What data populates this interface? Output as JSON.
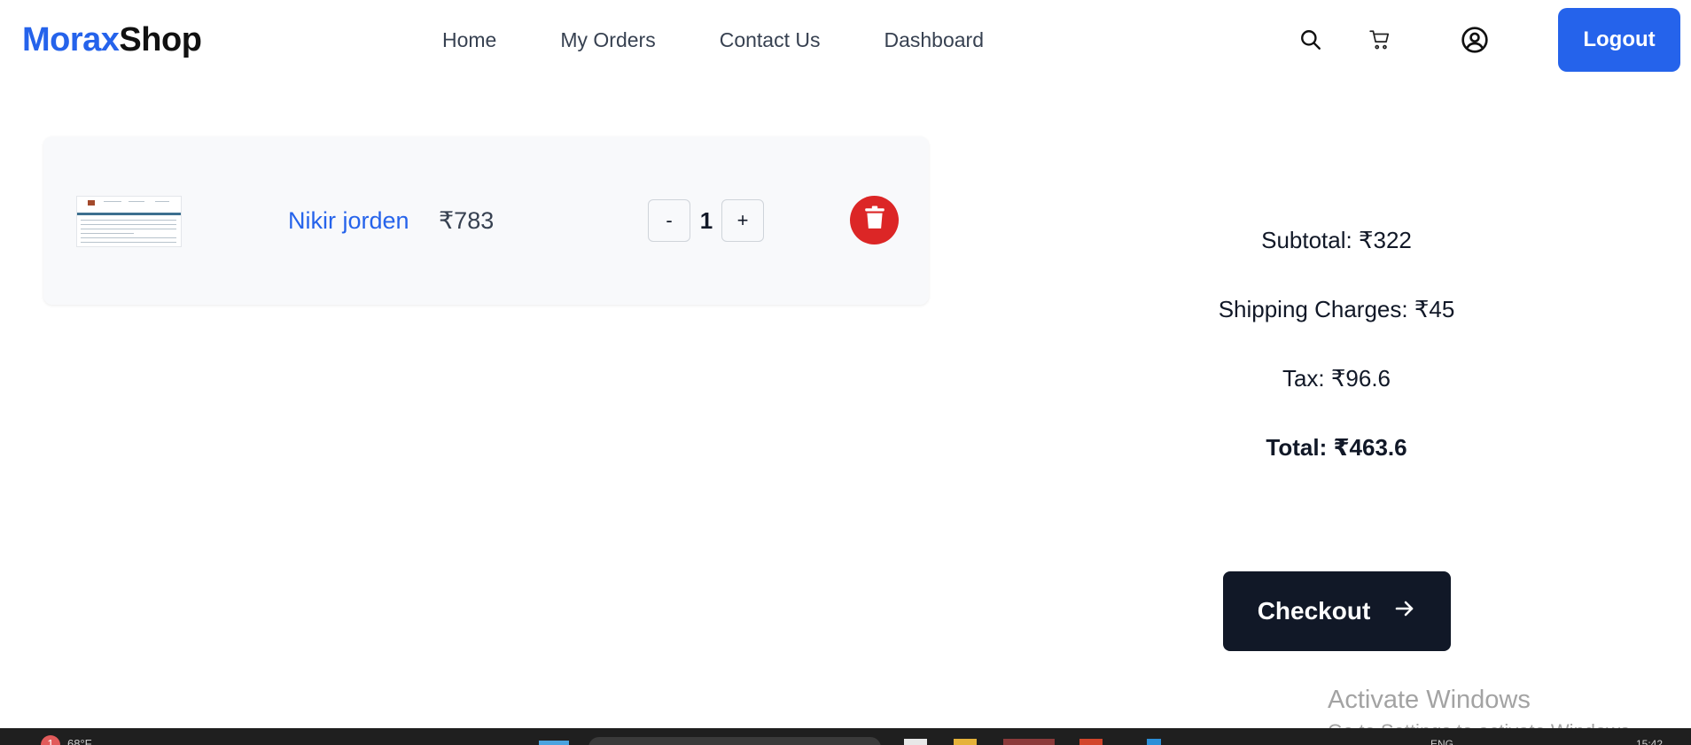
{
  "brand": {
    "part1": "Morax",
    "part2": "Shop",
    "color_primary": "#2563eb"
  },
  "nav": {
    "items": [
      {
        "label": "Home"
      },
      {
        "label": "My Orders"
      },
      {
        "label": "Contact Us"
      },
      {
        "label": "Dashboard"
      }
    ]
  },
  "header_actions": {
    "icons": [
      "search-icon",
      "cart-icon",
      "user-account-icon"
    ],
    "logout_label": "Logout"
  },
  "cart": {
    "items": [
      {
        "name": "Nikir jorden",
        "price": "₹783",
        "quantity": "1",
        "decrement_label": "-",
        "increment_label": "+"
      }
    ]
  },
  "summary": {
    "subtotal": "Subtotal: ₹322",
    "shipping": "Shipping Charges: ₹45",
    "tax": "Tax: ₹96.6",
    "total": "Total: ₹463.6",
    "checkout_label": "Checkout"
  },
  "watermark": {
    "line1": "Activate Windows",
    "line2": "Go to Settings to activate Windows."
  },
  "taskbar": {
    "notification_count": "1",
    "temperature": "68°F",
    "language": "ENG",
    "time": "15:42"
  },
  "colors": {
    "accent": "#2563eb",
    "danger": "#dc2626",
    "dark_button": "#111827",
    "card_bg": "#f8f9fb"
  }
}
